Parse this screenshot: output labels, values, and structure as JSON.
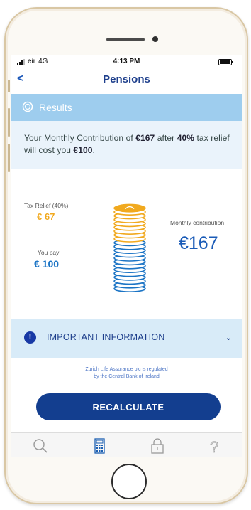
{
  "status_bar": {
    "carrier": "eir",
    "network": "4G",
    "time": "4:13 PM"
  },
  "nav": {
    "back_icon": "<",
    "title": "Pensions"
  },
  "results": {
    "icon": "results-ring-icon",
    "label": "Results"
  },
  "summary": {
    "part1": "Your Monthly Contribution of ",
    "amount": "€167",
    "part2": " after ",
    "rate": "40%",
    "part3": " tax relief will cost you ",
    "cost": "€100",
    "part4": "."
  },
  "chart": {
    "tax_relief_label": "Tax Relief (40%)",
    "tax_relief_value": "€ 67",
    "you_pay_label": "You pay",
    "you_pay_value": "€ 100",
    "monthly_label": "Monthly contribution",
    "monthly_value": "€167",
    "colors": {
      "tax_relief": "#f1a91e",
      "you_pay": "#1b74c5"
    }
  },
  "info": {
    "label": "IMPORTANT INFORMATION",
    "badge": "!",
    "chevron": "⌄"
  },
  "regulated": {
    "line1": "Zurich Life Assurance plc is regulated",
    "line2": "by the Central Bank of Ireland"
  },
  "recalculate_label": "RECALCULATE",
  "tabbar": {
    "items": [
      "search-icon",
      "calculator-icon",
      "lock-icon",
      "help-icon"
    ],
    "help_glyph": "?"
  }
}
